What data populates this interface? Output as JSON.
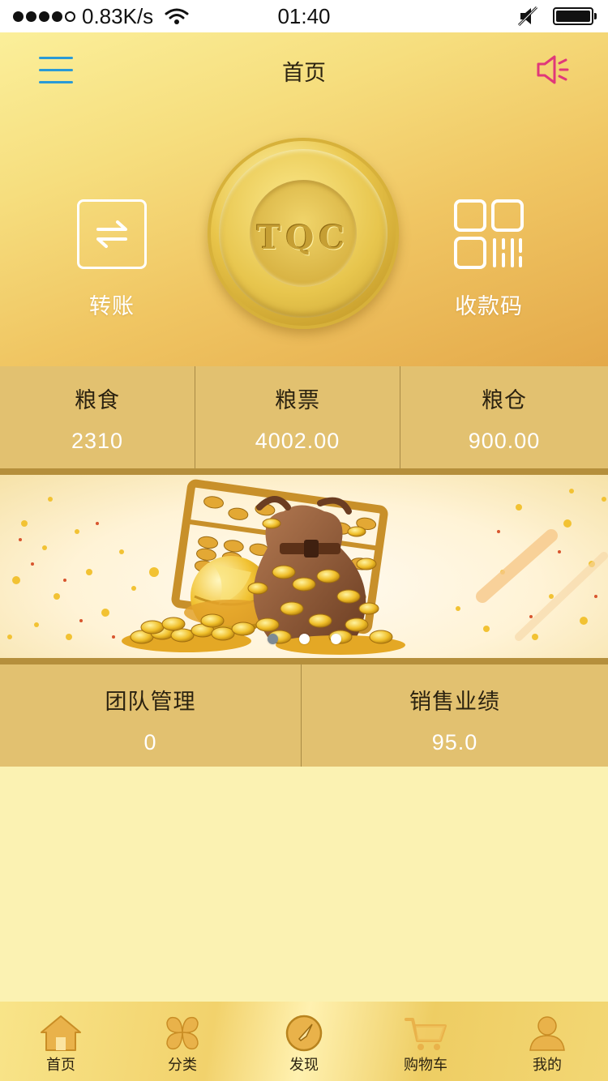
{
  "status_bar": {
    "network_speed": "0.83K/s",
    "time": "01:40"
  },
  "header": {
    "title": "首页"
  },
  "actions": {
    "transfer_label": "转账",
    "qrcode_label": "收款码"
  },
  "coin": {
    "text": "TQC"
  },
  "stats_top": [
    {
      "label": "粮食",
      "value": "2310"
    },
    {
      "label": "粮票",
      "value": "4002.00"
    },
    {
      "label": "粮仓",
      "value": "900.00"
    }
  ],
  "stats_bottom": [
    {
      "label": "团队管理",
      "value": "0"
    },
    {
      "label": "销售业绩",
      "value": "95.0"
    }
  ],
  "banner": {
    "slide_count": 3,
    "active_slide": 1
  },
  "tabs": [
    {
      "label": "首页",
      "icon": "home-icon"
    },
    {
      "label": "分类",
      "icon": "category-icon"
    },
    {
      "label": "发现",
      "icon": "compass-icon"
    },
    {
      "label": "购物车",
      "icon": "cart-icon"
    },
    {
      "label": "我的",
      "icon": "user-icon"
    }
  ],
  "colors": {
    "hero_top": "#fbef9a",
    "hero_bottom": "#e4a94a",
    "stats_bg": "#e2c170",
    "page_bg": "#fbf2b2",
    "menu_accent": "#2a9ad6",
    "speaker_accent": "#e0387a"
  }
}
